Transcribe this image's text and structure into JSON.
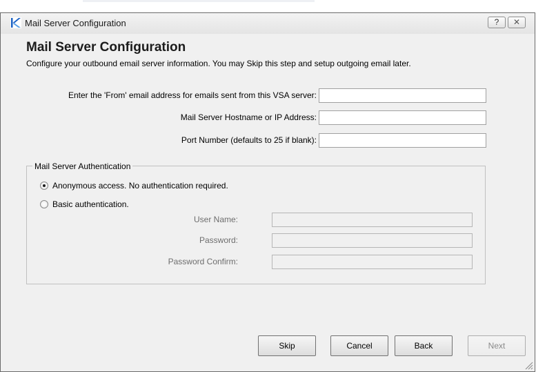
{
  "window": {
    "title": "Mail Server Configuration",
    "help_glyph": "?",
    "close_glyph": "✕"
  },
  "header": {
    "title": "Mail Server Configuration",
    "subtitle": "Configure your outbound email server information.  You may Skip this step and setup outgoing email later."
  },
  "form": {
    "from_label": "Enter the 'From' email address for emails sent from this VSA server:",
    "from_value": "",
    "host_label": "Mail Server Hostname or IP Address:",
    "host_value": "",
    "port_label": "Port Number (defaults to 25 if blank):",
    "port_value": ""
  },
  "auth": {
    "group_title": "Mail Server Authentication",
    "anonymous_label": "Anonymous access.  No authentication required.",
    "basic_label": "Basic authentication.",
    "selected": "anonymous",
    "username_label": "User Name:",
    "username_value": "",
    "password_label": "Password:",
    "password_value": "",
    "confirm_label": "Password Confirm:",
    "confirm_value": ""
  },
  "buttons": {
    "skip": "Skip",
    "cancel": "Cancel",
    "back": "Back",
    "next": "Next"
  },
  "colors": {
    "dialog_bg": "#f0f0f0",
    "app_icon": "#1e63c4"
  },
  "icons": {
    "app": "kaseya-logo-icon",
    "help": "help-icon",
    "close": "close-icon",
    "grip": "resize-grip-icon"
  }
}
